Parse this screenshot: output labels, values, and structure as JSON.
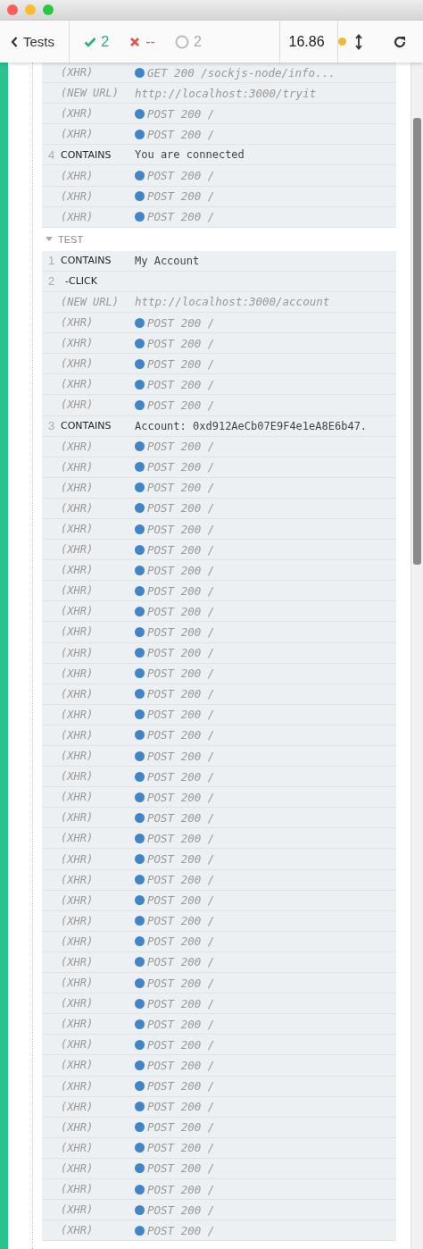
{
  "toolbar": {
    "back": "Tests",
    "passed": "2",
    "failed": "--",
    "pending": "2",
    "duration": "16.86"
  },
  "sections": [
    {
      "rows": [
        {
          "kind": "xhr",
          "name": "(XHR)",
          "message": "GET 200 /sockjs-node/info..."
        },
        {
          "kind": "url",
          "name": "(NEW URL)",
          "message": "http://localhost:3000/tryit"
        },
        {
          "kind": "xhr",
          "name": "(XHR)",
          "message": "POST 200 /"
        },
        {
          "kind": "xhr",
          "name": "(XHR)",
          "message": "POST 200 /"
        },
        {
          "kind": "command",
          "number": "4",
          "name": "CONTAINS",
          "message": "You are connected"
        },
        {
          "kind": "xhr",
          "name": "(XHR)",
          "message": "POST 200 /"
        },
        {
          "kind": "xhr",
          "name": "(XHR)",
          "message": "POST 200 /"
        },
        {
          "kind": "xhr",
          "name": "(XHR)",
          "message": "POST 200 /"
        }
      ]
    },
    {
      "header": "TEST",
      "rows": [
        {
          "kind": "command",
          "number": "1",
          "name": "CONTAINS",
          "message": "My Account"
        },
        {
          "kind": "child",
          "number": "2",
          "name": "-CLICK"
        },
        {
          "kind": "url",
          "name": "(NEW URL)",
          "message": "http://localhost:3000/account"
        },
        {
          "kind": "xhr",
          "name": "(XHR)",
          "message": "POST 200 /"
        },
        {
          "kind": "xhr",
          "name": "(XHR)",
          "message": "POST 200 /"
        },
        {
          "kind": "xhr",
          "name": "(XHR)",
          "message": "POST 200 /"
        },
        {
          "kind": "xhr",
          "name": "(XHR)",
          "message": "POST 200 /"
        },
        {
          "kind": "xhr",
          "name": "(XHR)",
          "message": "POST 200 /"
        },
        {
          "kind": "command",
          "number": "3",
          "name": "CONTAINS",
          "message": "Account: 0xd912AeCb07E9F4e1eA8E6b47."
        },
        {
          "kind": "xhr",
          "name": "(XHR)",
          "message": "POST 200 /"
        },
        {
          "kind": "xhr",
          "name": "(XHR)",
          "message": "POST 200 /"
        },
        {
          "kind": "xhr",
          "name": "(XHR)",
          "message": "POST 200 /"
        },
        {
          "kind": "xhr",
          "name": "(XHR)",
          "message": "POST 200 /"
        },
        {
          "kind": "xhr",
          "name": "(XHR)",
          "message": "POST 200 /"
        },
        {
          "kind": "xhr",
          "name": "(XHR)",
          "message": "POST 200 /"
        },
        {
          "kind": "xhr",
          "name": "(XHR)",
          "message": "POST 200 /"
        },
        {
          "kind": "xhr",
          "name": "(XHR)",
          "message": "POST 200 /"
        },
        {
          "kind": "xhr",
          "name": "(XHR)",
          "message": "POST 200 /"
        },
        {
          "kind": "xhr",
          "name": "(XHR)",
          "message": "POST 200 /"
        },
        {
          "kind": "xhr",
          "name": "(XHR)",
          "message": "POST 200 /"
        },
        {
          "kind": "xhr",
          "name": "(XHR)",
          "message": "POST 200 /"
        },
        {
          "kind": "xhr",
          "name": "(XHR)",
          "message": "POST 200 /"
        },
        {
          "kind": "xhr",
          "name": "(XHR)",
          "message": "POST 200 /"
        },
        {
          "kind": "xhr",
          "name": "(XHR)",
          "message": "POST 200 /"
        },
        {
          "kind": "xhr",
          "name": "(XHR)",
          "message": "POST 200 /"
        },
        {
          "kind": "xhr",
          "name": "(XHR)",
          "message": "POST 200 /"
        },
        {
          "kind": "xhr",
          "name": "(XHR)",
          "message": "POST 200 /"
        },
        {
          "kind": "xhr",
          "name": "(XHR)",
          "message": "POST 200 /"
        },
        {
          "kind": "xhr",
          "name": "(XHR)",
          "message": "POST 200 /"
        },
        {
          "kind": "xhr",
          "name": "(XHR)",
          "message": "POST 200 /"
        },
        {
          "kind": "xhr",
          "name": "(XHR)",
          "message": "POST 200 /"
        },
        {
          "kind": "xhr",
          "name": "(XHR)",
          "message": "POST 200 /"
        },
        {
          "kind": "xhr",
          "name": "(XHR)",
          "message": "POST 200 /"
        },
        {
          "kind": "xhr",
          "name": "(XHR)",
          "message": "POST 200 /"
        },
        {
          "kind": "xhr",
          "name": "(XHR)",
          "message": "POST 200 /"
        },
        {
          "kind": "xhr",
          "name": "(XHR)",
          "message": "POST 200 /"
        },
        {
          "kind": "xhr",
          "name": "(XHR)",
          "message": "POST 200 /"
        },
        {
          "kind": "xhr",
          "name": "(XHR)",
          "message": "POST 200 /"
        },
        {
          "kind": "xhr",
          "name": "(XHR)",
          "message": "POST 200 /"
        },
        {
          "kind": "xhr",
          "name": "(XHR)",
          "message": "POST 200 /"
        },
        {
          "kind": "xhr",
          "name": "(XHR)",
          "message": "POST 200 /"
        },
        {
          "kind": "xhr",
          "name": "(XHR)",
          "message": "POST 200 /"
        },
        {
          "kind": "xhr",
          "name": "(XHR)",
          "message": "POST 200 /"
        },
        {
          "kind": "xhr",
          "name": "(XHR)",
          "message": "POST 200 /"
        },
        {
          "kind": "xhr",
          "name": "(XHR)",
          "message": "POST 200 /"
        },
        {
          "kind": "xhr",
          "name": "(XHR)",
          "message": "POST 200 /"
        },
        {
          "kind": "xhr",
          "name": "(XHR)",
          "message": "POST 200 /"
        },
        {
          "kind": "xhr",
          "name": "(XHR)",
          "message": "POST 200 /"
        }
      ]
    }
  ]
}
